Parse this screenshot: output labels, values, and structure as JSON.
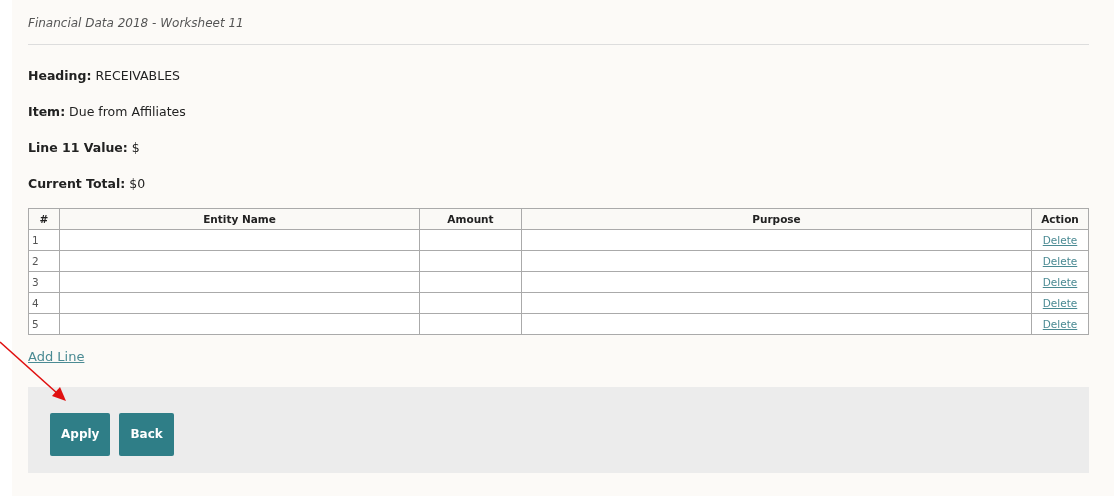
{
  "title": "Financial Data 2018 - Worksheet 11",
  "details": [
    "**Heading:** RECEIVABLES",
    "**Item:** Due from Affiliates",
    "**Line 11 Value:** $",
    "**Current Total:** $0"
  ],
  "table": {
    "columns": [
      "#",
      "Entity Name",
      "Amount",
      "Purpose",
      "Action"
    ],
    "rows": [
      {
        "number": "1",
        "action": "Delete"
      },
      {
        "number": "2",
        "action": "Delete"
      },
      {
        "number": "3",
        "action": "Delete"
      },
      {
        "number": "4",
        "action": "Delete"
      },
      {
        "number": "5",
        "action": "Delete"
      }
    ]
  },
  "add_line": "Add Line",
  "buttons": [
    "Apply",
    "Back"
  ]
}
